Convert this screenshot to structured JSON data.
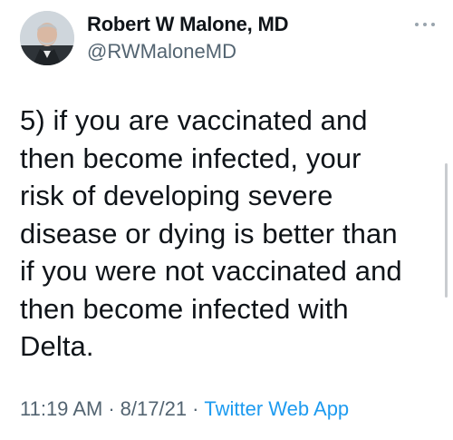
{
  "author": {
    "name": "Robert W Malone, MD",
    "handle": "@RWMaloneMD",
    "avatar_icon": "profile-photo"
  },
  "more_icon": "more-dots-icon",
  "tweet": {
    "text": "5) if you are vaccinated and\nthen become infected, your\nrisk of developing severe\ndisease or dying is better than\nif you were not vaccinated and\nthen become infected with\nDelta."
  },
  "meta": {
    "time": "11:19 AM",
    "separator": "·",
    "date": "8/17/21",
    "source": "Twitter Web App"
  },
  "colors": {
    "text": "#0f1419",
    "secondary": "#536471",
    "link": "#1d9bf0"
  }
}
